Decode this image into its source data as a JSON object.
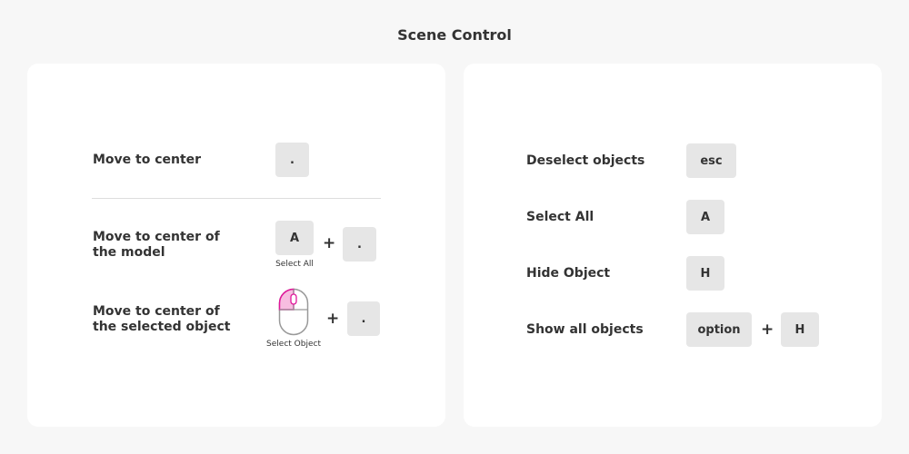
{
  "title": "Scene Control",
  "colors": {
    "background": "#f7f7f7",
    "panel": "#ffffff",
    "key": "#e6e6e6",
    "mouse_highlight": "#e0169a"
  },
  "left_panel": {
    "rows": [
      {
        "label": "Move to center",
        "keys": [
          "."
        ]
      },
      {
        "label": "Move to center of the model",
        "keys": [
          "A",
          "."
        ],
        "separator": "+",
        "caption": "Select All"
      },
      {
        "label": "Move to center of the selected object",
        "icon": "mouse-left-click-icon",
        "keys": [
          "."
        ],
        "separator": "+",
        "caption": "Select Object"
      }
    ]
  },
  "right_panel": {
    "rows": [
      {
        "label": "Deselect objects",
        "keys": [
          "esc"
        ]
      },
      {
        "label": "Select All",
        "keys": [
          "A"
        ]
      },
      {
        "label": "Hide Object",
        "keys": [
          "H"
        ]
      },
      {
        "label": "Show all objects",
        "keys": [
          "option",
          "H"
        ],
        "separator": "+"
      }
    ]
  }
}
